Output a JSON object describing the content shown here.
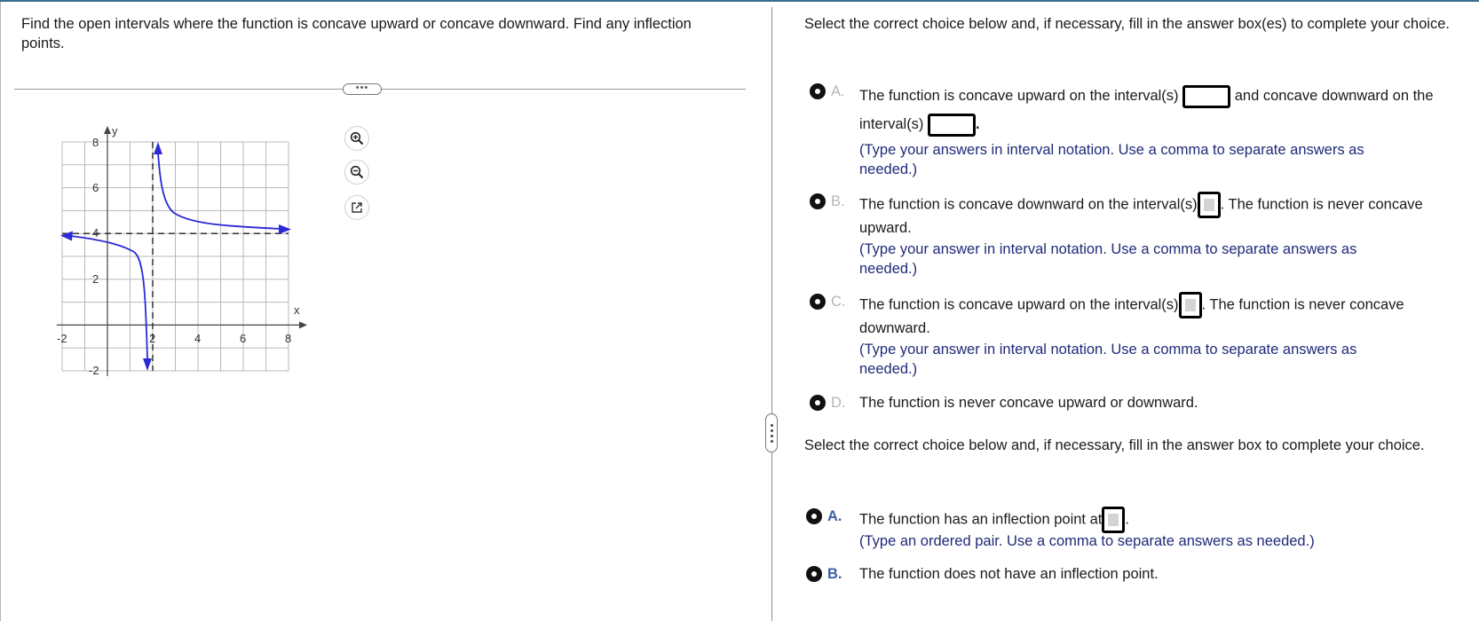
{
  "question": {
    "text": "Find the open intervals where the function is concave upward or concave downward. Find any inflection points."
  },
  "toolbar": {
    "more_label": "•••",
    "zoom_in_icon": "zoom-in-icon",
    "zoom_out_icon": "zoom-out-icon",
    "popout_icon": "external-link-icon"
  },
  "graph": {
    "x_axis_label": "x",
    "y_axis_label": "y",
    "x_ticks": [
      "-2",
      "2",
      "4",
      "6",
      "8"
    ],
    "y_ticks": [
      "8",
      "6",
      "4",
      "2",
      "-2"
    ],
    "x_range": [
      -2,
      8
    ],
    "y_range": [
      -2,
      8
    ],
    "vertical_asymptote": 2,
    "horizontal_asymptote": 4,
    "curve_color": "#2b2bd6"
  },
  "part1": {
    "prompt": "Select the correct choice below and, if necessary, fill in the answer box(es) to complete your choice.",
    "choices": [
      {
        "letter": "A.",
        "text_a": "The function is concave upward on the interval(s)",
        "text_b": "and concave downward on the interval(s)",
        "text_c": ".",
        "hint": "(Type your answers in interval notation. Use a comma to separate answers as needed.)"
      },
      {
        "letter": "B.",
        "text_a": "The function is concave downward on the interval(s)",
        "text_b": ". The function is never concave upward.",
        "hint": "(Type your answer in interval notation. Use a comma to separate answers as needed.)"
      },
      {
        "letter": "C.",
        "text_a": "The function is concave upward on the interval(s)",
        "text_b": ". The function is never concave downward.",
        "hint": "(Type your answer in interval notation. Use a comma to separate answers as needed.)"
      },
      {
        "letter": "D.",
        "text_a": "The function is never concave upward or downward."
      }
    ]
  },
  "part2": {
    "prompt": "Select the correct choice below and, if necessary, fill in the answer box to complete your choice.",
    "choices": [
      {
        "letter": "A.",
        "text_a": "The function has an inflection point at",
        "text_b": ".",
        "hint": "(Type an ordered pair. Use a comma to separate answers as needed.)"
      },
      {
        "letter": "B.",
        "text_a": "The function does not have an inflection point."
      }
    ]
  }
}
